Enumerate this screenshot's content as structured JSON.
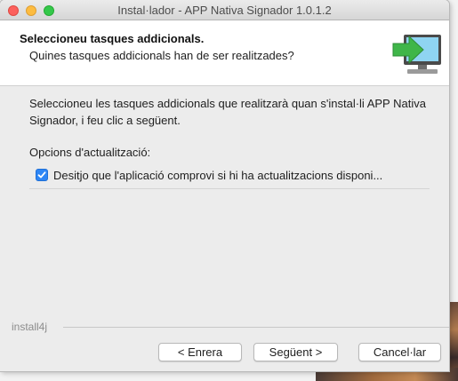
{
  "window": {
    "title": "Instal·lador - APP Nativa Signador 1.0.1.2"
  },
  "header": {
    "title": "Seleccioneu tasques addicionals.",
    "subtitle": "Quines tasques addicionals han de ser realitzades?",
    "icon": "installer-monitor-arrow-icon"
  },
  "body": {
    "intro": "Seleccioneu les tasques addicionals que realitzarà quan s'instal·li APP Nativa Signador, i feu clic a següent.",
    "group_label": "Opcions d'actualització:",
    "options": [
      {
        "label": "Desitjo que l'aplicació comprovi si hi ha actualitzacions disponi...",
        "checked": true
      }
    ]
  },
  "footer": {
    "brand": "install4j",
    "back_label": "< Enrera",
    "next_label": "Següent >",
    "cancel_label": "Cancel·lar"
  },
  "colors": {
    "accent": "#2d86f5",
    "icon_green": "#3fb649",
    "icon_screen": "#8fd4f2"
  }
}
